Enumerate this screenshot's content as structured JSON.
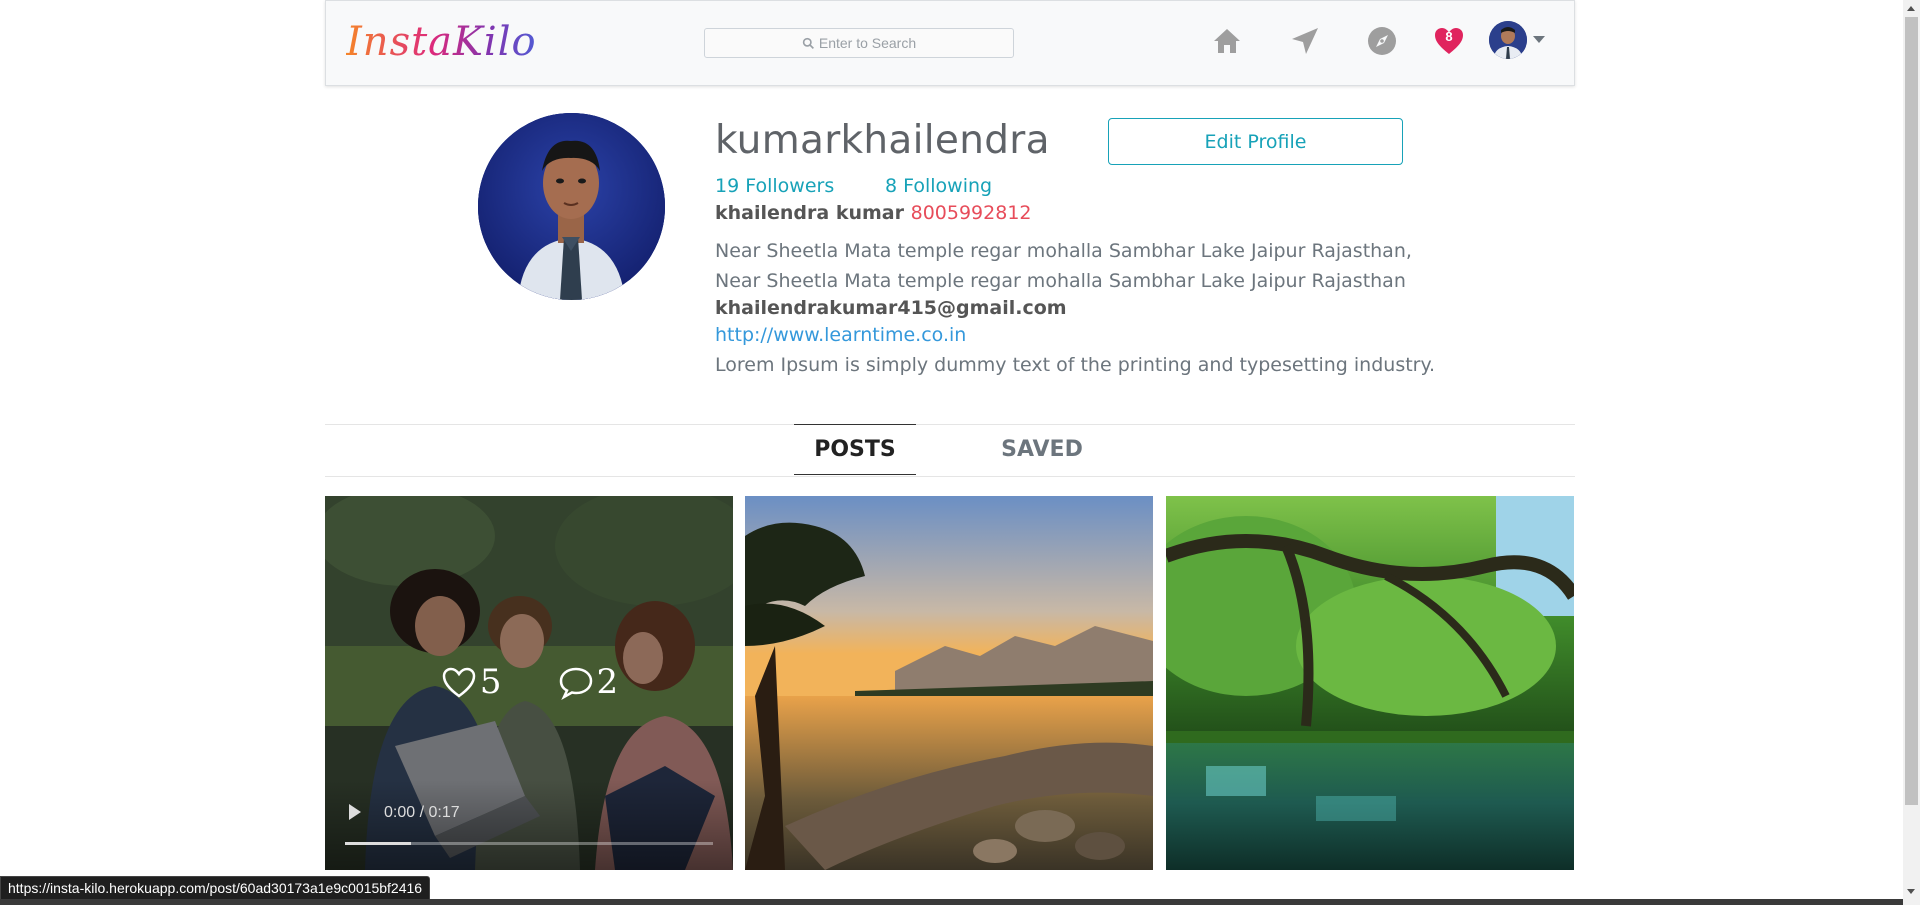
{
  "navbar": {
    "logo": "InstaKilo",
    "search_placeholder": "Enter to Search",
    "icons": [
      "home-icon",
      "send-icon",
      "explore-icon",
      "notifications-heart-icon",
      "profile-avatar"
    ],
    "notification_count": "8"
  },
  "profile": {
    "username": "kumarkhailendra",
    "edit_button": "Edit Profile",
    "followers": "19 Followers",
    "following": "8 Following",
    "full_name": "khailendra kumar",
    "phone": "8005992812",
    "address_line1": "Near Sheetla Mata temple regar mohalla Sambhar Lake Jaipur Rajasthan,",
    "address_line2": "Near Sheetla Mata temple regar mohalla Sambhar Lake Jaipur Rajasthan",
    "email": "khailendrakumar415@gmail.com",
    "website": "http://www.learntime.co.in",
    "bio": "Lorem Ipsum is simply dummy text of the printing and typesetting industry."
  },
  "tabs": {
    "posts": "POSTS",
    "saved": "SAVED",
    "active": "POSTS"
  },
  "posts": [
    {
      "type": "video",
      "likes": "5",
      "comments": "2",
      "time": "0:00 / 0:17",
      "progress": 0.18
    },
    {
      "type": "image"
    },
    {
      "type": "image"
    }
  ],
  "status_url": "https://insta-kilo.herokuapp.com/post/60ad30173a1e9c0015bf2416",
  "colors": {
    "accent": "#17a2b8",
    "phone": "#e74c5a",
    "link": "#3498db",
    "heart": "#e0245e"
  }
}
